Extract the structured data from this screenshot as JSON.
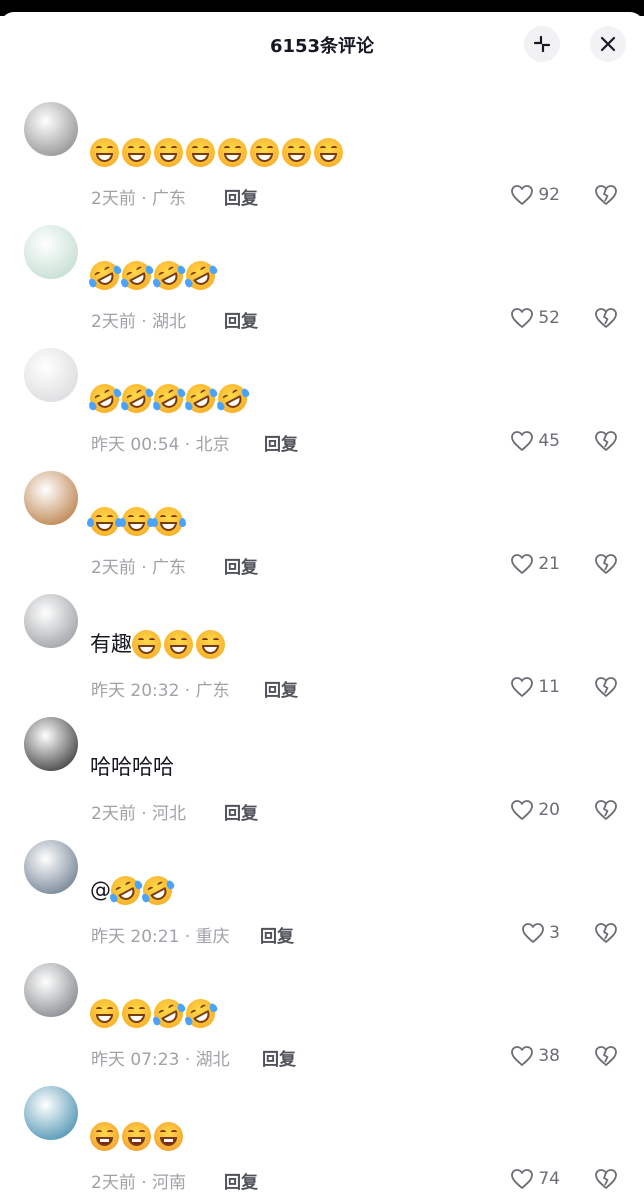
{
  "header": {
    "title": "6153条评论"
  },
  "comments": [
    {
      "text": "",
      "emojis": [
        "grin",
        "grin",
        "grin",
        "grin",
        "grin",
        "grin",
        "grin",
        "grin"
      ],
      "meta": "2天前 · 广东",
      "reply": "回复",
      "likes": "92",
      "avatar_color": "#7d7d7d"
    },
    {
      "text": "",
      "emojis": [
        "rofl",
        "rofl",
        "rofl",
        "rofl"
      ],
      "meta": "2天前 · 湖北",
      "reply": "回复",
      "likes": "52",
      "avatar_color": "#b9d7c8"
    },
    {
      "text": "",
      "emojis": [
        "rofl",
        "rofl",
        "rofl",
        "rofl",
        "rofl"
      ],
      "meta": "昨天 00:54 · 北京",
      "reply": "回复",
      "likes": "45",
      "avatar_color": "#d5d5d8"
    },
    {
      "text": "",
      "emojis": [
        "joy",
        "joy",
        "joy"
      ],
      "meta": "2天前 · 广东",
      "reply": "回复",
      "likes": "21",
      "avatar_color": "#b06a2a"
    },
    {
      "text": "有趣",
      "emojis": [
        "grin",
        "grin",
        "grin"
      ],
      "meta": "昨天 20:32 · 广东",
      "reply": "回复",
      "likes": "11",
      "avatar_color": "#8a8f94"
    },
    {
      "text": "哈哈哈哈",
      "emojis": [],
      "meta": "2天前 · 河北",
      "reply": "回复",
      "likes": "20",
      "avatar_color": "#1a1a1a"
    },
    {
      "text": "@",
      "emojis": [
        "rofl",
        "rofl"
      ],
      "meta": "昨天 20:21 · 重庆",
      "reply": "回复",
      "likes": "3",
      "avatar_color": "#566a7e"
    },
    {
      "text": "",
      "emojis": [
        "grin",
        "grin",
        "rofl",
        "rofl"
      ],
      "meta": "昨天 07:23 · 湖北",
      "reply": "回复",
      "likes": "38",
      "avatar_color": "#6d7378"
    },
    {
      "text": "",
      "emojis": [
        "laugh",
        "laugh",
        "laugh"
      ],
      "meta": "2天前 · 河南",
      "reply": "回复",
      "likes": "74",
      "avatar_color": "#2b7fa3"
    }
  ],
  "icons": {
    "collapse": "collapse-icon",
    "close": "close-icon",
    "like": "heart-icon",
    "dislike": "broken-heart-icon"
  },
  "colors": {
    "meta_text": "#a1a2a7",
    "reply_text": "#505259",
    "header_button_bg": "#f2f2f4"
  }
}
